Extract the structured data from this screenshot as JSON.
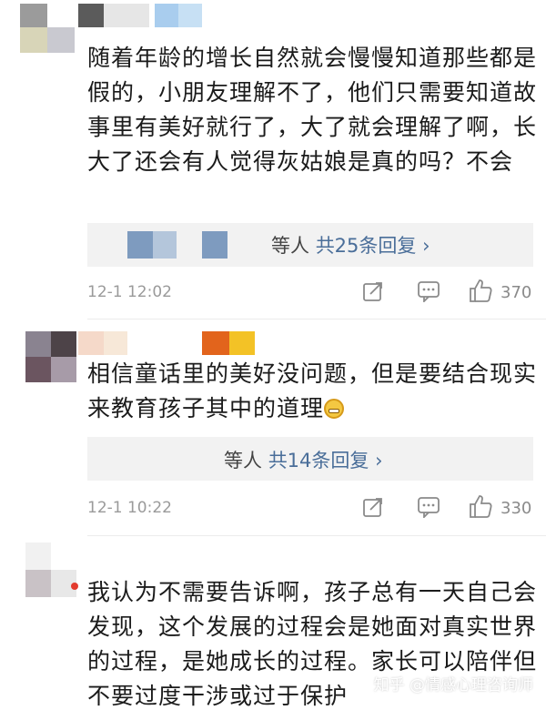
{
  "comments": [
    {
      "text": "随着年龄的增长自然就会慢慢知道那些都是假的，小朋友理解不了，他们只需要知道故事里有美好就行了，大了就会理解了啊，长大了还会有人觉得灰姑娘是真的吗？不会",
      "reply_prefix": "等人",
      "reply_count_label": "共25条回复",
      "reply_chevron": "›",
      "time": "12-1 12:02",
      "likes": "370"
    },
    {
      "text": "相信童话里的美好没问题，但是要结合现实来教育孩子其中的道理",
      "reply_prefix": "等人",
      "reply_count_label": "共14条回复",
      "reply_chevron": "›",
      "time": "12-1 10:22",
      "likes": "330"
    },
    {
      "text": "我认为不需要告诉啊，孩子总有一天自己会发现，这个发展的过程会是她面对真实世界的过程，是她成长的过程。家长可以陪伴但不要过度干涉或过于保护"
    }
  ],
  "watermark": "知乎 @情感心理咨询师",
  "icons": {
    "repost": "repost-icon",
    "comment": "comment-icon",
    "like": "thumbs-up-icon",
    "emoji": "grimace-emoji-icon"
  },
  "colors": {
    "link": "#4a6e99",
    "reply_bg": "#f2f2f2",
    "meta": "#9a9a9a"
  }
}
